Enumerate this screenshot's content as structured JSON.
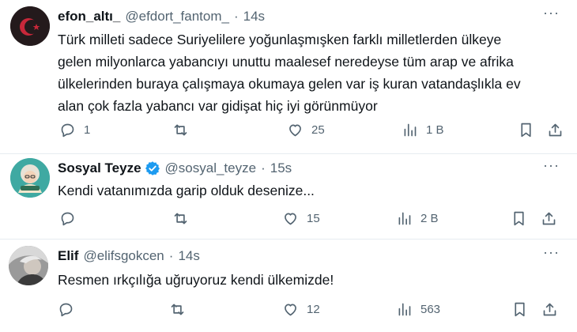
{
  "tweets": [
    {
      "name": "efon_altı_",
      "handle": "@efdort_fantom_",
      "sep": "·",
      "time": "14s",
      "text_lines": [
        "Türk milleti sadece Suriyelilere yoğunlaşmışken farklı milletlerden ülkeye",
        "gelen milyonlarca yabancıyı unuttu maalesef neredeyse tüm arap ve afrika",
        "ülkelerinden buraya çalışmaya okumaya gelen var iş kuran vatandaşlıkla ev",
        "alan çok fazla yabancı var gidişat hiç iyi görünmüyor"
      ],
      "replies": "1",
      "reposts": "",
      "likes": "25",
      "views": "1 B",
      "more": "···"
    },
    {
      "name": "Sosyal Teyze",
      "verified": true,
      "handle": "@sosyal_teyze",
      "sep": "·",
      "time": "15s",
      "text_lines": [
        "Kendi vatanımızda garip olduk desenize..."
      ],
      "replies": "",
      "reposts": "",
      "likes": "15",
      "views": "2 B",
      "more": "···"
    },
    {
      "name": "Elif",
      "handle": "@elifsgokcen",
      "sep": "·",
      "time": "14s",
      "text_lines": [
        "Resmen ırkçılığa uğruyoruz kendi ülkemizde!"
      ],
      "replies": "",
      "reposts": "",
      "likes": "12",
      "views": "563",
      "more": "···"
    }
  ],
  "colors": {
    "text": "#0f1419",
    "muted": "#536471",
    "verified": "#1d9bf0"
  },
  "icons": [
    "reply-icon",
    "repost-icon",
    "like-icon",
    "views-icon",
    "bookmark-icon",
    "share-icon",
    "more-icon",
    "verified-icon"
  ]
}
